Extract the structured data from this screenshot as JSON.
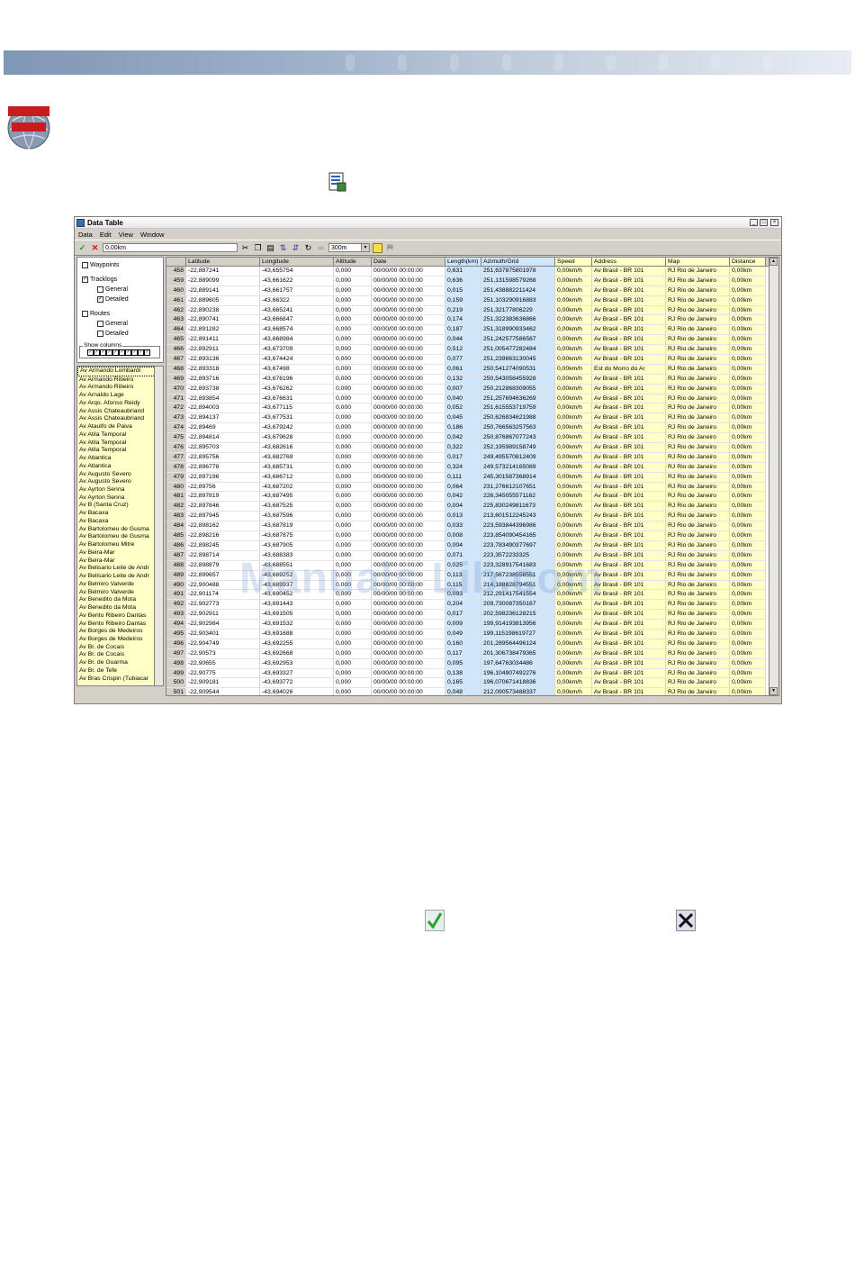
{
  "window": {
    "title": "Data Table",
    "menu": [
      "Data",
      "Edit",
      "View",
      "Window"
    ],
    "filter_value": "0,00km",
    "distance_option": "300m"
  },
  "tree": {
    "waypoints": "Waypoints",
    "tracklogs": "Tracklogs",
    "tracklogs_general": "General",
    "tracklogs_detailed": "Detailed",
    "routes": "Routes",
    "routes_general": "General",
    "routes_detailed": "Detailed",
    "show_columns": "Show columns"
  },
  "streets": [
    "Av Armando Lombardi",
    "Av Armando Ribeiro",
    "Av Armando Ribeiro",
    "Av Arnaldo Lage",
    "Av Arqo. Afonso Reidy",
    "Av Assis Chateaubriand",
    "Av Assis Chateaubriand",
    "Av Ataulfo de Paiva",
    "Av Atila Temporal",
    "Av Atila Temporal",
    "Av Atila Temporal",
    "Av Atlantica",
    "Av Atlantica",
    "Av Augusto Severo",
    "Av Augusto Severo",
    "Av Ayrton Senna",
    "Av Ayrton Senna",
    "Av B (Santa Cruz)",
    "Av Bacaxa",
    "Av Bacaxa",
    "Av Bartolomeu de Gusma",
    "Av Bartolomeu de Gusma",
    "Av Bartolomeu Mitre",
    "Av Beira-Mar",
    "Av Beira-Mar",
    "Av Belisario Leite de Andr",
    "Av Belisario Leite de Andr",
    "Av Belmiro Valverde",
    "Av Belmiro Valverde",
    "Av Benedito da Mota",
    "Av Benedito da Mota",
    "Av Bento Ribeiro Dantas",
    "Av Bento Ribeiro Dantas",
    "Av Borges de Medeiros",
    "Av Borges de Medeiros",
    "Av Br. de Cocais",
    "Av Br. de Cocais",
    "Av Br. de Guarma",
    "Av Br. de Tefe",
    "Av Bras Crispin (Tubiacar"
  ],
  "columns": [
    "",
    "Latitude",
    "Longitude",
    "Altitude",
    "Date",
    "Length(km)",
    "Azimuth/Grid",
    "Speed",
    "Address",
    "Map",
    "Distance"
  ],
  "rows": [
    [
      "458",
      "-22,887241",
      "-43,655754",
      "0,000",
      "00/00/00 00:00:00",
      "0,631",
      "251,637875801978",
      "0,00km/h",
      "Av Brasil - BR 101",
      "RJ Rio de Janeiro",
      "0,00km"
    ],
    [
      "459",
      "-22,889099",
      "-43,661622",
      "0,000",
      "00/00/00 00:00:00",
      "0,636",
      "251,131598579268",
      "0,00km/h",
      "Av Brasil - BR 101",
      "RJ Rio de Janeiro",
      "0,00km"
    ],
    [
      "460",
      "-22,889141",
      "-43,661757",
      "0,000",
      "00/00/00 00:00:00",
      "0,015",
      "251,438882211424",
      "0,00km/h",
      "Av Brasil - BR 101",
      "RJ Rio de Janeiro",
      "0,00km"
    ],
    [
      "461",
      "-22,889605",
      "-43,66322",
      "0,000",
      "00/00/00 00:00:00",
      "0,159",
      "251,103290916883",
      "0,00km/h",
      "Av Brasil - BR 101",
      "RJ Rio de Janeiro",
      "0,00km"
    ],
    [
      "462",
      "-22,890238",
      "-43,665241",
      "0,000",
      "00/00/00 00:00:00",
      "0,219",
      "251,32177806229",
      "0,00km/h",
      "Av Brasil - BR 101",
      "RJ Rio de Janeiro",
      "0,00km"
    ],
    [
      "463",
      "-22,890741",
      "-43,666847",
      "0,000",
      "00/00/00 00:00:00",
      "0,174",
      "251,322383636866",
      "0,00km/h",
      "Av Brasil - BR 101",
      "RJ Rio de Janeiro",
      "0,00km"
    ],
    [
      "464",
      "-22,891282",
      "-43,668574",
      "0,000",
      "00/00/00 00:00:00",
      "0,187",
      "251,318990933462",
      "0,00km/h",
      "Av Brasil - BR 101",
      "RJ Rio de Janeiro",
      "0,00km"
    ],
    [
      "465",
      "-22,891411",
      "-43,668984",
      "0,000",
      "00/00/00 00:00:00",
      "0,044",
      "251,242577586587",
      "0,00km/h",
      "Av Brasil - BR 101",
      "RJ Rio de Janeiro",
      "0,00km"
    ],
    [
      "466",
      "-22,892911",
      "-43,673709",
      "0,000",
      "00/00/00 00:00:00",
      "0,512",
      "251,005477282484",
      "0,00km/h",
      "Av Brasil - BR 101",
      "RJ Rio de Janeiro",
      "0,00km"
    ],
    [
      "467",
      "-22,893136",
      "-43,674424",
      "0,000",
      "00/00/00 00:00:00",
      "0,077",
      "251,239863130045",
      "0,00km/h",
      "Av Brasil - BR 101",
      "RJ Rio de Janeiro",
      "0,00km"
    ],
    [
      "468",
      "-22,893318",
      "-43,67498",
      "0,000",
      "00/00/00 00:00:00",
      "0,061",
      "250,541274090531",
      "0,00km/h",
      "Est do Morro do Ar",
      "RJ Rio de Janeiro",
      "0,00km"
    ],
    [
      "469",
      "-22,893716",
      "-43,676196",
      "0,000",
      "00/00/00 00:00:00",
      "0,132",
      "250,543058455928",
      "0,00km/h",
      "Av Brasil - BR 101",
      "RJ Rio de Janeiro",
      "0,00km"
    ],
    [
      "470",
      "-22,893738",
      "-43,676262",
      "0,000",
      "00/00/00 00:00:00",
      "0,007",
      "250,212868309055",
      "0,00km/h",
      "Av Brasil - BR 101",
      "RJ Rio de Janeiro",
      "0,00km"
    ],
    [
      "471",
      "-22,893854",
      "-43,676631",
      "0,000",
      "00/00/00 00:00:00",
      "0,040",
      "251,257694636269",
      "0,00km/h",
      "Av Brasil - BR 101",
      "RJ Rio de Janeiro",
      "0,00km"
    ],
    [
      "472",
      "-22,894003",
      "-43,677115",
      "0,000",
      "00/00/00 00:00:00",
      "0,052",
      "251,615553719759",
      "0,00km/h",
      "Av Brasil - BR 101",
      "RJ Rio de Janeiro",
      "0,00km"
    ],
    [
      "473",
      "-22,894137",
      "-43,677531",
      "0,000",
      "00/00/00 00:00:00",
      "0,045",
      "250,626834621988",
      "0,00km/h",
      "Av Brasil - BR 101",
      "RJ Rio de Janeiro",
      "0,00km"
    ],
    [
      "474",
      "-22,89469",
      "-43,679242",
      "0,000",
      "00/00/00 00:00:00",
      "0,186",
      "250,766563257563",
      "0,00km/h",
      "Av Brasil - BR 101",
      "RJ Rio de Janeiro",
      "0,00km"
    ],
    [
      "475",
      "-22,894814",
      "-43,679628",
      "0,000",
      "00/00/00 00:00:00",
      "0,042",
      "250,876867077243",
      "0,00km/h",
      "Av Brasil - BR 101",
      "RJ Rio de Janeiro",
      "0,00km"
    ],
    [
      "476",
      "-22,895703",
      "-43,682616",
      "0,000",
      "00/00/00 00:00:00",
      "0,322",
      "252,195989158749",
      "0,00km/h",
      "Av Brasil - BR 101",
      "RJ Rio de Janeiro",
      "0,00km"
    ],
    [
      "477",
      "-22,895756",
      "-43,682769",
      "0,000",
      "00/00/00 00:00:00",
      "0,017",
      "249,495570812409",
      "0,00km/h",
      "Av Brasil - BR 101",
      "RJ Rio de Janeiro",
      "0,00km"
    ],
    [
      "478",
      "-22,896778",
      "-43,685731",
      "0,000",
      "00/00/00 00:00:00",
      "0,324",
      "249,573214165089",
      "0,00km/h",
      "Av Brasil - BR 101",
      "RJ Rio de Janeiro",
      "0,00km"
    ],
    [
      "479",
      "-22,897196",
      "-43,686712",
      "0,000",
      "00/00/00 00:00:00",
      "0,111",
      "245,301587368914",
      "0,00km/h",
      "Av Brasil - BR 101",
      "RJ Rio de Janeiro",
      "0,00km"
    ],
    [
      "480",
      "-22,89756",
      "-43,687202",
      "0,000",
      "00/00/00 00:00:00",
      "0,064",
      "231,276612107651",
      "0,00km/h",
      "Av Brasil - BR 101",
      "RJ Rio de Janeiro",
      "0,00km"
    ],
    [
      "481",
      "-22,897819",
      "-43,687495",
      "0,000",
      "00/00/00 00:00:00",
      "0,042",
      "226,345055571162",
      "0,00km/h",
      "Av Brasil - BR 101",
      "RJ Rio de Janeiro",
      "0,00km"
    ],
    [
      "482",
      "-22,897846",
      "-43,687525",
      "0,000",
      "00/00/00 00:00:00",
      "0,004",
      "225,830249811673",
      "0,00km/h",
      "Av Brasil - BR 101",
      "RJ Rio de Janeiro",
      "0,00km"
    ],
    [
      "483",
      "-22,897945",
      "-43,687596",
      "0,000",
      "00/00/00 00:00:00",
      "0,013",
      "213,601512245243",
      "0,00km/h",
      "Av Brasil - BR 101",
      "RJ Rio de Janeiro",
      "0,00km"
    ],
    [
      "484",
      "-22,898162",
      "-43,687819",
      "0,000",
      "00/00/00 00:00:00",
      "0,033",
      "223,593844396986",
      "0,00km/h",
      "Av Brasil - BR 101",
      "RJ Rio de Janeiro",
      "0,00km"
    ],
    [
      "485",
      "-22,898216",
      "-43,687875",
      "0,000",
      "00/00/00 00:00:00",
      "0,008",
      "223,854090454165",
      "0,00km/h",
      "Av Brasil - BR 101",
      "RJ Rio de Janeiro",
      "0,00km"
    ],
    [
      "486",
      "-22,898245",
      "-43,687905",
      "0,000",
      "00/00/00 00:00:00",
      "0,004",
      "223,783490377697",
      "0,00km/h",
      "Av Brasil - BR 101",
      "RJ Rio de Janeiro",
      "0,00km"
    ],
    [
      "487",
      "-22,898714",
      "-43,688383",
      "0,000",
      "00/00/00 00:00:00",
      "0,071",
      "223,3572233325",
      "0,00km/h",
      "Av Brasil - BR 101",
      "RJ Rio de Janeiro",
      "0,00km"
    ],
    [
      "488",
      "-22,898879",
      "-43,688551",
      "0,000",
      "00/00/00 00:00:00",
      "0,025",
      "223,328917541683",
      "0,00km/h",
      "Av Brasil - BR 101",
      "RJ Rio de Janeiro",
      "0,00km"
    ],
    [
      "489",
      "-22,899657",
      "-43,689252",
      "0,000",
      "00/00/00 00:00:00",
      "0,113",
      "217,567238558551",
      "0,00km/h",
      "Av Brasil - BR 101",
      "RJ Rio de Janeiro",
      "0,00km"
    ],
    [
      "490",
      "-22,900488",
      "-43,689937",
      "0,000",
      "00/00/00 00:00:00",
      "0,115",
      "214,188828794551",
      "0,00km/h",
      "Av Brasil - BR 101",
      "RJ Rio de Janeiro",
      "0,00km"
    ],
    [
      "491",
      "-22,901174",
      "-43,690452",
      "0,000",
      "00/00/00 00:00:00",
      "0,093",
      "212,291417541554",
      "0,00km/h",
      "Av Brasil - BR 101",
      "RJ Rio de Janeiro",
      "0,00km"
    ],
    [
      "492",
      "-22,902773",
      "-43,691443",
      "0,000",
      "00/00/00 00:00:00",
      "0,204",
      "209,730087350167",
      "0,00km/h",
      "Av Brasil - BR 101",
      "RJ Rio de Janeiro",
      "0,00km"
    ],
    [
      "493",
      "-22,902911",
      "-43,691505",
      "0,000",
      "00/00/00 00:00:00",
      "0,017",
      "202,598236128215",
      "0,00km/h",
      "Av Brasil - BR 101",
      "RJ Rio de Janeiro",
      "0,00km"
    ],
    [
      "494",
      "-22,902984",
      "-43,691532",
      "0,000",
      "00/00/00 00:00:00",
      "0,009",
      "199,914193813956",
      "0,00km/h",
      "Av Brasil - BR 101",
      "RJ Rio de Janeiro",
      "0,00km"
    ],
    [
      "495",
      "-22,903401",
      "-43,691688",
      "0,000",
      "00/00/00 00:00:00",
      "0,049",
      "199,115198619727",
      "0,00km/h",
      "Av Brasil - BR 101",
      "RJ Rio de Janeiro",
      "0,00km"
    ],
    [
      "496",
      "-22,904749",
      "-43,692255",
      "0,000",
      "00/00/00 00:00:00",
      "0,160",
      "201,289564496124",
      "0,00km/h",
      "Av Brasil - BR 101",
      "RJ Rio de Janeiro",
      "0,00km"
    ],
    [
      "497",
      "-22,90573",
      "-43,692668",
      "0,000",
      "00/00/00 00:00:00",
      "0,117",
      "201,306738479365",
      "0,00km/h",
      "Av Brasil - BR 101",
      "RJ Rio de Janeiro",
      "0,00km"
    ],
    [
      "498",
      "-22,90655",
      "-43,692953",
      "0,000",
      "00/00/00 00:00:00",
      "0,095",
      "197,64763034486",
      "0,00km/h",
      "Av Brasil - BR 101",
      "RJ Rio de Janeiro",
      "0,00km"
    ],
    [
      "499",
      "-22,90775",
      "-43,693327",
      "0,000",
      "00/00/00 00:00:00",
      "0,138",
      "196,104907492276",
      "0,00km/h",
      "Av Brasil - BR 101",
      "RJ Rio de Janeiro",
      "0,00km"
    ],
    [
      "500",
      "-22,909181",
      "-43,693772",
      "0,000",
      "00/00/00 00:00:00",
      "0,165",
      "196,070671418836",
      "0,00km/h",
      "Av Brasil - BR 101",
      "RJ Rio de Janeiro",
      "0,00km"
    ],
    [
      "501",
      "-22,909544",
      "-43,694026",
      "0,000",
      "00/00/00 00:00:00",
      "0,048",
      "212,090573488337",
      "0,00km/h",
      "Av Brasil - BR 101",
      "RJ Rio de Janeiro",
      "0,00km"
    ]
  ],
  "watermark": "Manuals Lib.com",
  "colors": {
    "window_face": "#d4d0c8",
    "blue_columns": "#cfe6fb",
    "yellow_columns": "#ffffc8",
    "banner": "#8fa4bf"
  }
}
